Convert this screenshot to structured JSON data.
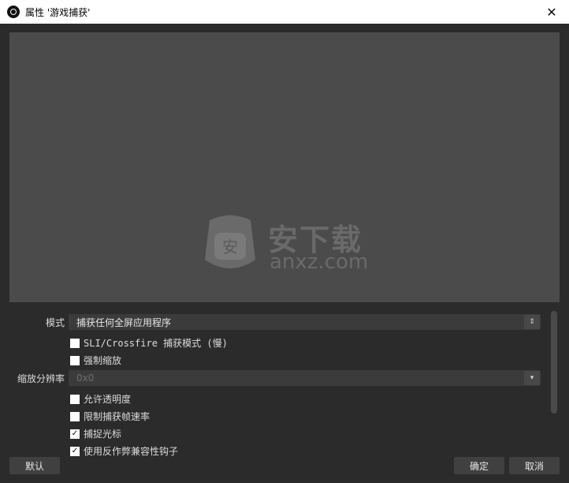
{
  "window": {
    "title": "属性 '游戏捕获'",
    "close_label": "✕"
  },
  "watermark": {
    "brand": "安下载",
    "site": "anxz.com",
    "shield_char": "安"
  },
  "props": {
    "mode_label": "模式",
    "mode_value": "捕获任何全屏应用程序",
    "scale_label": "缩放分辨率",
    "scale_value": "0x0",
    "checkboxes": [
      {
        "label": "SLI/Crossfire 捕获模式 (慢)",
        "checked": false
      },
      {
        "label": "强制缩放",
        "checked": false
      },
      {
        "label": "允许透明度",
        "checked": false
      },
      {
        "label": "限制捕获帧速率",
        "checked": false
      },
      {
        "label": "捕捉光标",
        "checked": true
      },
      {
        "label": "使用反作弊兼容性钩子",
        "checked": true
      }
    ]
  },
  "buttons": {
    "defaults": "默认",
    "ok": "确定",
    "cancel": "取消"
  },
  "icons": {
    "app": "obs-icon",
    "combo_arrow": "updown-icon",
    "dropdown_arrow": "chevron-down-icon"
  }
}
